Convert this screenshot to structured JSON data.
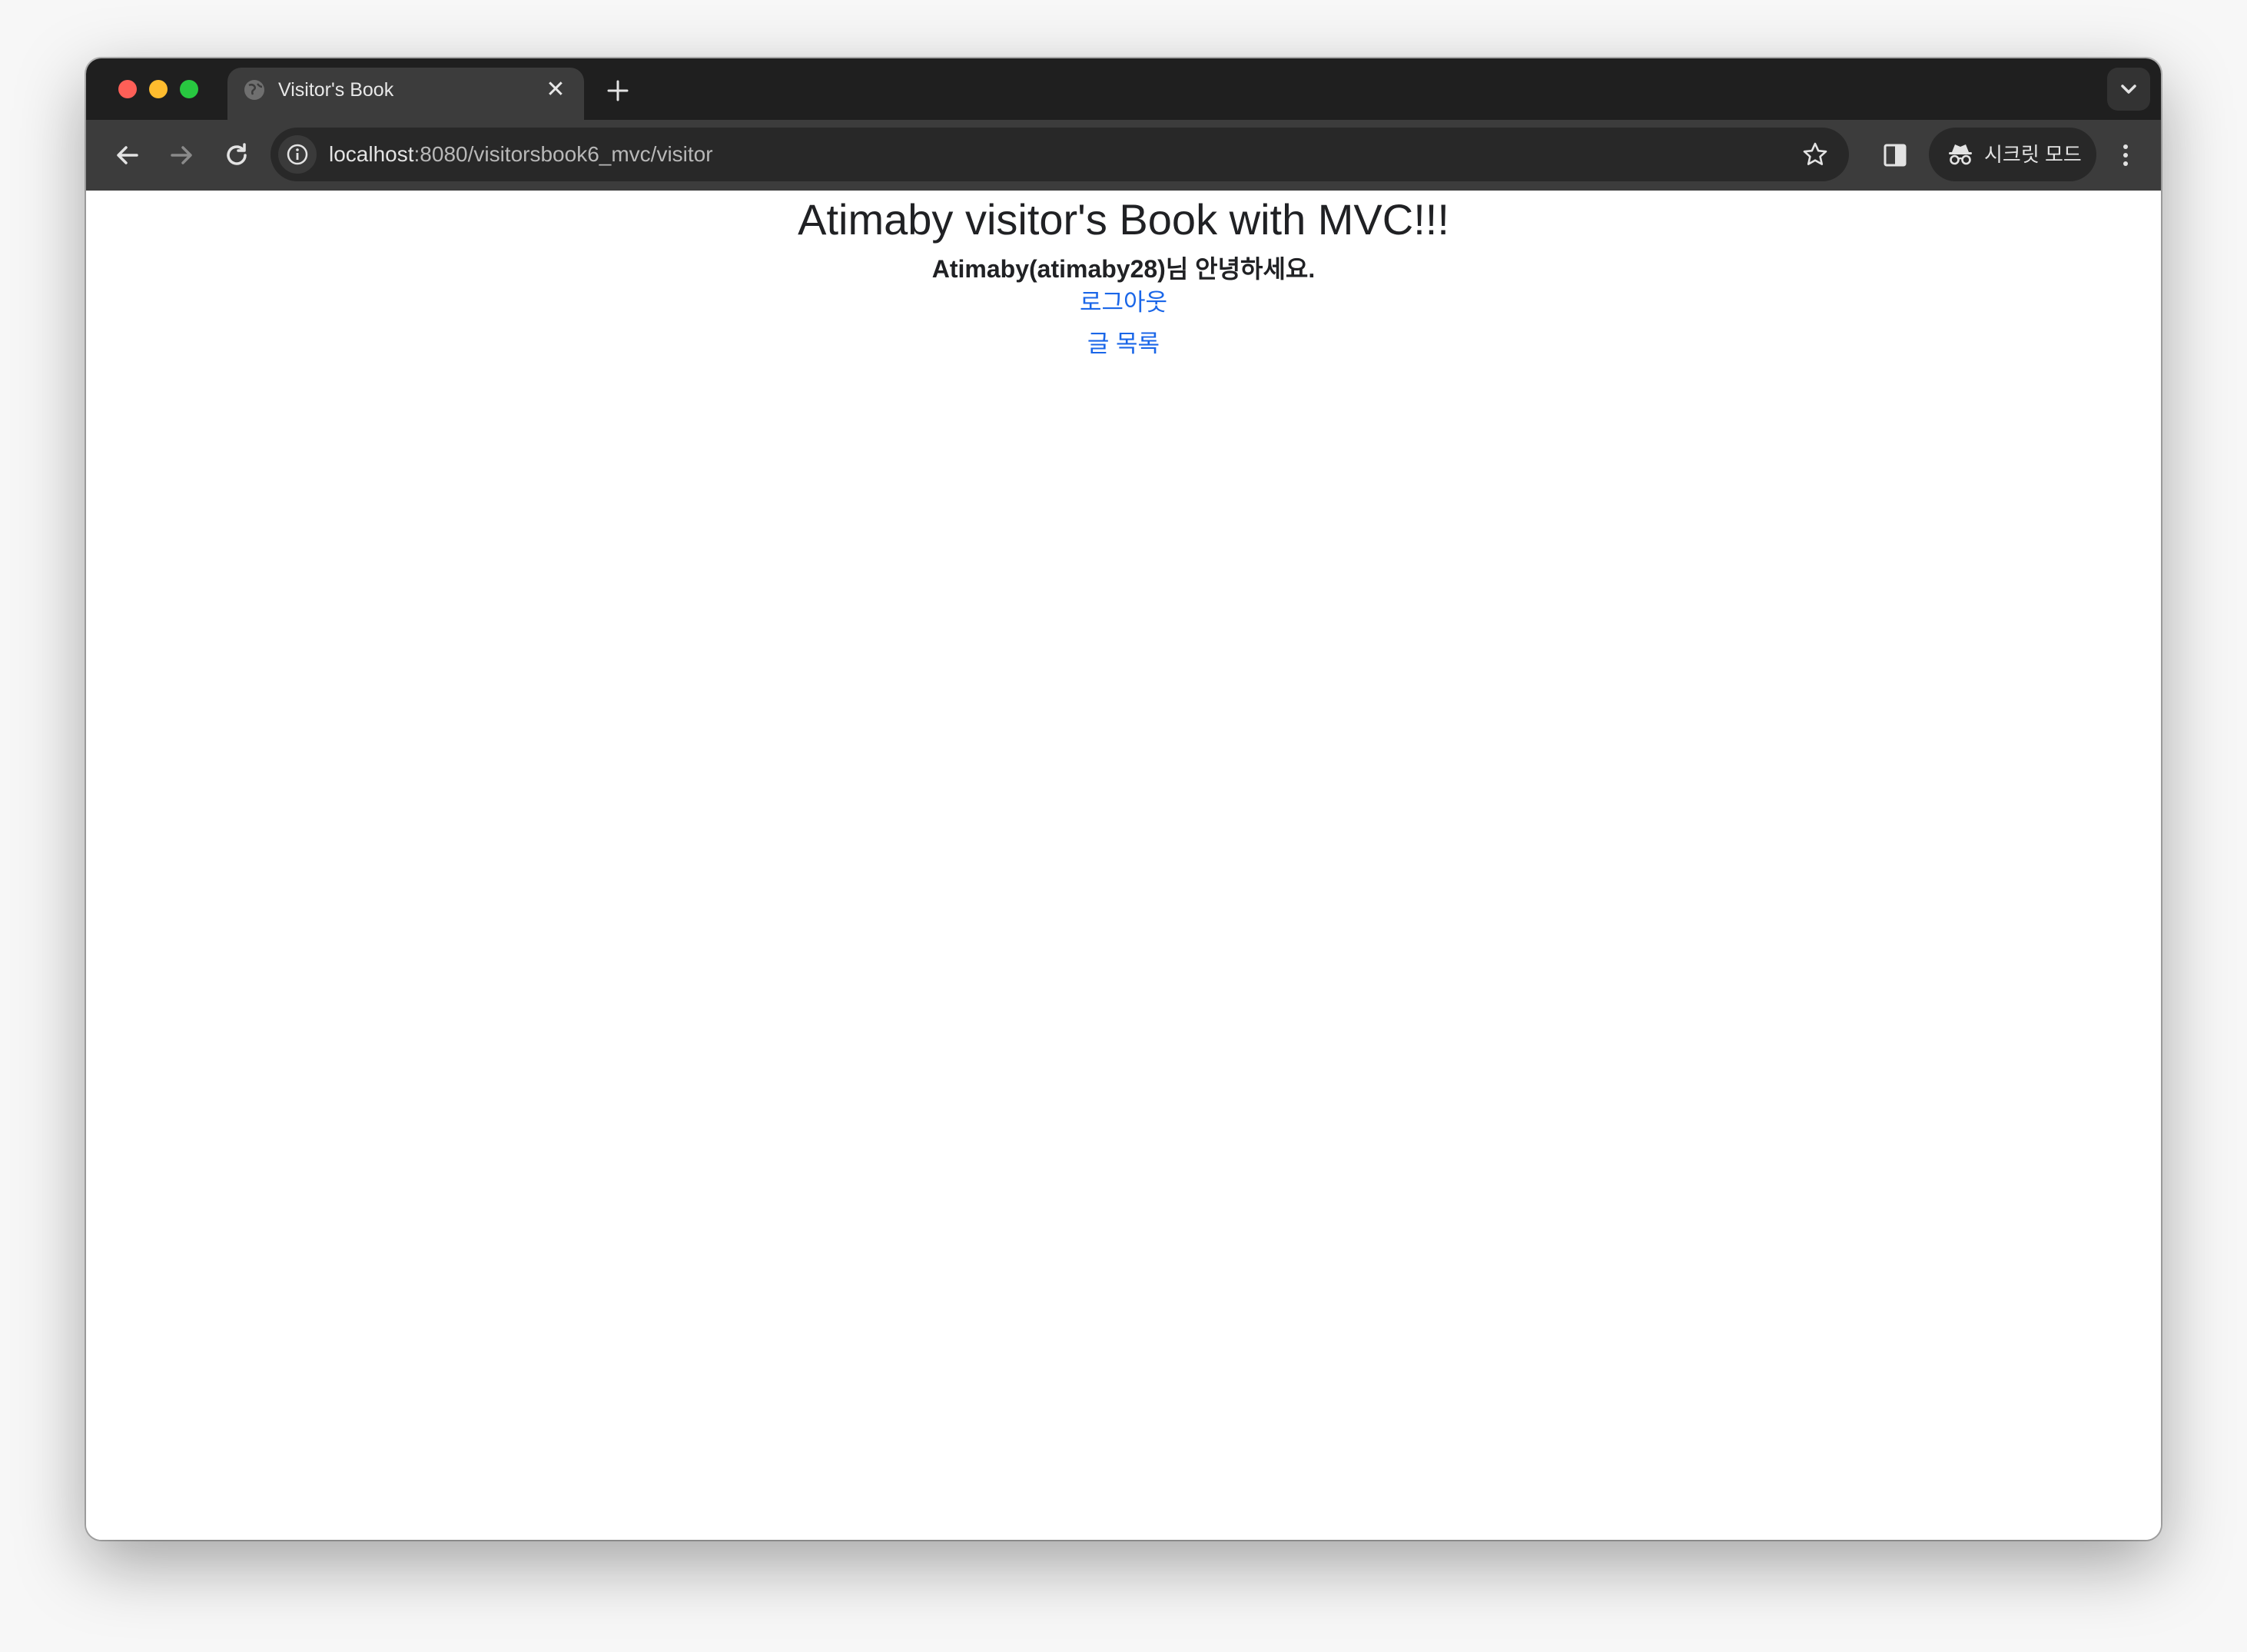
{
  "browser": {
    "tab": {
      "title": "Visitor's Book",
      "close_glyph": "✕"
    },
    "address_bar": {
      "host": "localhost",
      "path": ":8080/visitorsbook6_mvc/visitor"
    },
    "incognito_label": "시크릿 모드"
  },
  "page": {
    "heading": "Atimaby visitor's Book with MVC!!!",
    "greeting": "Atimaby(atimaby28)님 안녕하세요.",
    "links": {
      "logout": "로그아웃",
      "list": "글 목록"
    }
  },
  "colors": {
    "tabstrip_bg": "#1f1f1f",
    "toolbar_bg": "#3c3c3c",
    "link": "#1a66e8",
    "text": "#202124"
  },
  "icons": [
    "globe-icon",
    "close-icon",
    "plus-icon",
    "chevron-down-icon",
    "back-arrow-icon",
    "forward-arrow-icon",
    "reload-icon",
    "info-icon",
    "star-icon",
    "side-panel-icon",
    "incognito-icon",
    "more-vert-icon"
  ]
}
